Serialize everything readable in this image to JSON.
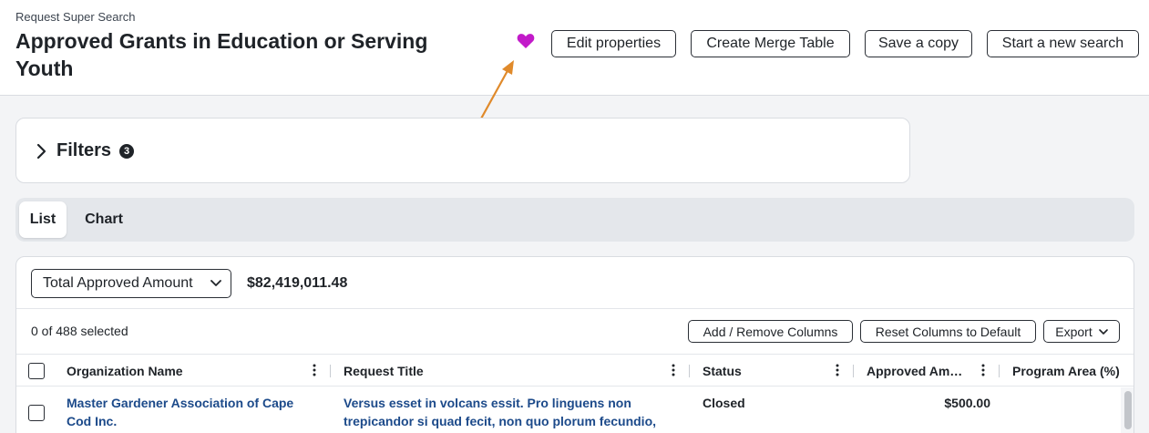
{
  "header": {
    "eyebrow": "Request Super Search",
    "title": "Approved Grants in Education or Serving Youth",
    "favorite_icon": "heart-icon",
    "buttons": {
      "edit": "Edit properties",
      "merge": "Create Merge Table",
      "copy": "Save a copy",
      "new_search": "Start a new search"
    }
  },
  "filters": {
    "label": "Filters",
    "count": "3"
  },
  "tabs": [
    {
      "label": "List",
      "active": true
    },
    {
      "label": "Chart",
      "active": false
    }
  ],
  "aggregate": {
    "selected": "Total Approved Amount",
    "value": "$82,419,011.48"
  },
  "table_toolbar": {
    "selection": "0 of 488 selected",
    "add_remove": "Add / Remove Columns",
    "reset": "Reset Columns to Default",
    "export": "Export"
  },
  "columns": {
    "org": "Organization Name",
    "title": "Request Title",
    "status": "Status",
    "amount": "Approved Am…",
    "program": "Program Area (%)"
  },
  "rows": [
    {
      "org": "Master Gardener Association of Cape Cod Inc.",
      "title": "Versus esset in volcans essit. Pro linguens non trepicandor si quad fecit, non quo plorum fecundio,",
      "status": "Closed",
      "amount": "$500.00",
      "program": ""
    }
  ],
  "colors": {
    "accent_heart": "#c21ac9",
    "link": "#1c4a8a",
    "annotation_arrow": "#e08a2b"
  }
}
